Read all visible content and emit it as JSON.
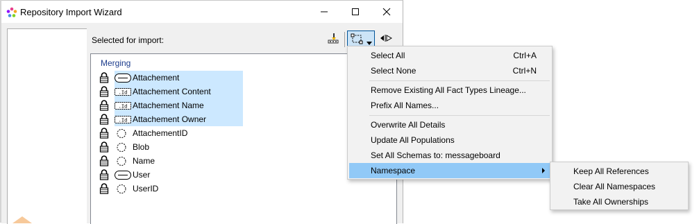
{
  "window": {
    "title": "Repository Import Wizard",
    "minimize_icon": "minimize-icon",
    "maximize_icon": "maximize-icon",
    "close_icon": "close-icon"
  },
  "import": {
    "selected_label": "Selected for import:",
    "group_label": "Merging",
    "items": [
      {
        "name": "Attachement",
        "kind": "entity",
        "highlighted": true
      },
      {
        "name": "Attachement Content",
        "kind": "value-entity",
        "highlighted": true
      },
      {
        "name": "Attachement Name",
        "kind": "value-entity",
        "highlighted": true
      },
      {
        "name": "Attachement Owner",
        "kind": "value-entity",
        "highlighted": true
      },
      {
        "name": "AttachementID",
        "kind": "value",
        "highlighted": false
      },
      {
        "name": "Blob",
        "kind": "value",
        "highlighted": false
      },
      {
        "name": "Name",
        "kind": "value",
        "highlighted": false
      },
      {
        "name": "User",
        "kind": "entity",
        "highlighted": false
      },
      {
        "name": "UserID",
        "kind": "value",
        "highlighted": false
      }
    ]
  },
  "toolbar": {
    "icons": [
      "run-icon",
      "select-options-icon",
      "chevron-down-icon",
      "expand-collapse-icon"
    ]
  },
  "menu": {
    "items": [
      {
        "label": "Select All",
        "shortcut": "Ctrl+A"
      },
      {
        "label": "Select None",
        "shortcut": "Ctrl+N"
      },
      {
        "label": "Remove Existing All Fact Types Lineage...",
        "shortcut": ""
      },
      {
        "label": "Prefix All Names...",
        "shortcut": ""
      },
      {
        "label": "Overwrite All Details",
        "shortcut": ""
      },
      {
        "label": "Update All Populations",
        "shortcut": ""
      },
      {
        "label": "Set All Schemas to: messageboard",
        "shortcut": ""
      },
      {
        "label": "Namespace",
        "shortcut": ""
      }
    ],
    "submenu": [
      {
        "label": "Keep All References"
      },
      {
        "label": "Clear All Namespaces"
      },
      {
        "label": "Take All Ownerships"
      }
    ]
  },
  "colors": {
    "highlight": "#cce8ff",
    "menu_hover": "#91c9f7",
    "group_label": "#1c3c8c"
  }
}
